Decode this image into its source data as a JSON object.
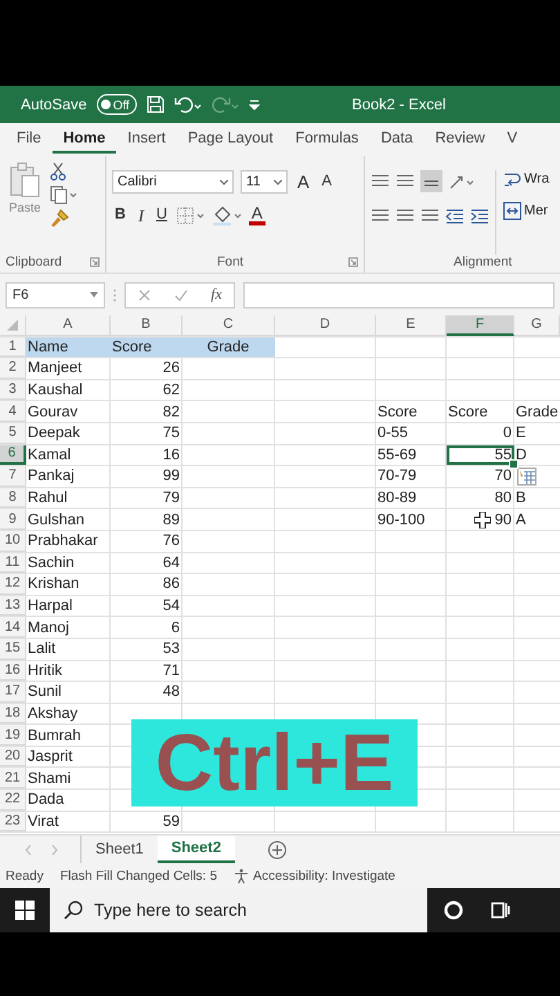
{
  "title_bar": {
    "autosave_label": "AutoSave",
    "autosave_toggle": {
      "label": "Off",
      "on": false
    },
    "title": "Book2 - Excel"
  },
  "ribbon_tabs": [
    {
      "label": "File",
      "selected": false
    },
    {
      "label": "Home",
      "selected": true
    },
    {
      "label": "Insert",
      "selected": false
    },
    {
      "label": "Page Layout",
      "selected": false
    },
    {
      "label": "Formulas",
      "selected": false
    },
    {
      "label": "Data",
      "selected": false
    },
    {
      "label": "Review",
      "selected": false
    },
    {
      "label": "V",
      "selected": false
    }
  ],
  "ribbon": {
    "clipboard": {
      "paste": "Paste",
      "label": "Clipboard"
    },
    "font": {
      "name": "Calibri",
      "size": "11",
      "grow": "A",
      "shrink": "A",
      "bold": "B",
      "italic": "I",
      "underline": "U",
      "font_color": "A",
      "label": "Font"
    },
    "alignment": {
      "wrap": "Wra",
      "merge": "Mer",
      "label": "Alignment"
    }
  },
  "name_box": "F6",
  "function_label": "fx",
  "columns": [
    {
      "label": "A",
      "selected": false
    },
    {
      "label": "B",
      "selected": false
    },
    {
      "label": "C",
      "selected": false
    },
    {
      "label": "D",
      "selected": false
    },
    {
      "label": "E",
      "selected": false
    },
    {
      "label": "F",
      "selected": true
    },
    {
      "label": "G",
      "selected": false
    }
  ],
  "rows": [
    {
      "number": "1",
      "kind": "header",
      "selected": false,
      "cells": {
        "A": "Name",
        "B": "Score",
        "C": "Grade"
      }
    },
    {
      "number": "2",
      "kind": "data",
      "selected": false,
      "cells": {
        "A": "Manjeet",
        "B": "26"
      }
    },
    {
      "number": "3",
      "kind": "data",
      "selected": false,
      "cells": {
        "A": "Kaushal",
        "B": "62"
      }
    },
    {
      "number": "4",
      "kind": "data",
      "selected": false,
      "cells": {
        "A": "Gourav",
        "B": "82",
        "E": "Score",
        "F": "Score",
        "G": "Grade"
      }
    },
    {
      "number": "5",
      "kind": "data",
      "selected": false,
      "cells": {
        "A": "Deepak",
        "B": "75",
        "E": "0-55",
        "F": "0",
        "G": "E"
      }
    },
    {
      "number": "6",
      "kind": "data",
      "selected": true,
      "cells": {
        "A": "Kamal",
        "B": "16",
        "E": "55-69",
        "F": "55",
        "G": "D"
      }
    },
    {
      "number": "7",
      "kind": "data",
      "selected": false,
      "cells": {
        "A": "Pankaj",
        "B": "99",
        "E": "70-79",
        "F": "70"
      }
    },
    {
      "number": "8",
      "kind": "data",
      "selected": false,
      "cells": {
        "A": "Rahul",
        "B": "79",
        "E": "80-89",
        "F": "80",
        "G": "B"
      }
    },
    {
      "number": "9",
      "kind": "data",
      "selected": false,
      "cells": {
        "A": "Gulshan",
        "B": "89",
        "E": "90-100",
        "F": "90",
        "G": "A"
      }
    },
    {
      "number": "10",
      "kind": "data",
      "selected": false,
      "cells": {
        "A": "Prabhakar",
        "B": "76"
      }
    },
    {
      "number": "11",
      "kind": "data",
      "selected": false,
      "cells": {
        "A": "Sachin",
        "B": "64"
      }
    },
    {
      "number": "12",
      "kind": "data",
      "selected": false,
      "cells": {
        "A": "Krishan",
        "B": "86"
      }
    },
    {
      "number": "13",
      "kind": "data",
      "selected": false,
      "cells": {
        "A": "Harpal",
        "B": "54"
      }
    },
    {
      "number": "14",
      "kind": "data",
      "selected": false,
      "cells": {
        "A": "Manoj",
        "B": "6"
      }
    },
    {
      "number": "15",
      "kind": "data",
      "selected": false,
      "cells": {
        "A": "Lalit",
        "B": "53"
      }
    },
    {
      "number": "16",
      "kind": "data",
      "selected": false,
      "cells": {
        "A": "Hritik",
        "B": "71"
      }
    },
    {
      "number": "17",
      "kind": "data",
      "selected": false,
      "cells": {
        "A": "Sunil",
        "B": "48"
      }
    },
    {
      "number": "18",
      "kind": "data",
      "selected": false,
      "cells": {
        "A": "Akshay"
      }
    },
    {
      "number": "19",
      "kind": "data",
      "selected": false,
      "cells": {
        "A": "Bumrah"
      }
    },
    {
      "number": "20",
      "kind": "data",
      "selected": false,
      "cells": {
        "A": "Jasprit"
      }
    },
    {
      "number": "21",
      "kind": "data",
      "selected": false,
      "cells": {
        "A": "Shami"
      }
    },
    {
      "number": "22",
      "kind": "data",
      "selected": false,
      "cells": {
        "A": "Dada"
      }
    },
    {
      "number": "23",
      "kind": "data",
      "selected": false,
      "cells": {
        "A": "Virat",
        "B": "59"
      }
    }
  ],
  "overlay_caption": "Ctrl+E",
  "sheet_tabs": [
    {
      "label": "Sheet1",
      "selected": false
    },
    {
      "label": "Sheet2",
      "selected": true
    }
  ],
  "status_bar": {
    "mode": "Ready",
    "message": "Flash Fill Changed Cells: 5",
    "accessibility": "Accessibility: Investigate"
  },
  "taskbar": {
    "search": {
      "placeholder": "Type here to search"
    }
  }
}
